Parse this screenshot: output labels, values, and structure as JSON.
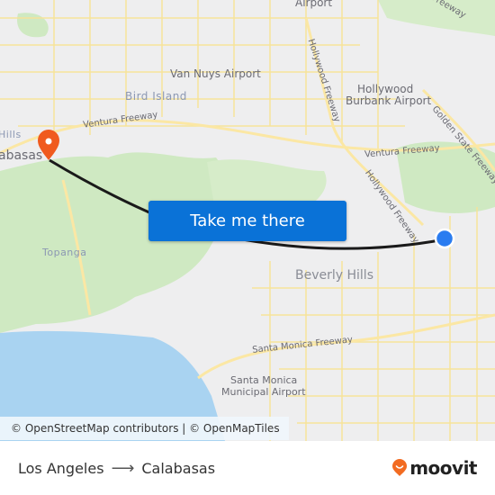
{
  "map": {
    "labels": {
      "airport_top": "Airport",
      "freeway_top_right": "Freeway",
      "van_nuys_airport": "Van Nuys Airport",
      "bird_island": "Bird Island",
      "ventura_freeway_left": "Ventura Freeway",
      "hills": "Hills",
      "calabasas_partial": "abasas",
      "hollywood_freeway_north": "Hollywood Freeway",
      "hollywood_burbank_airport_1": "Hollywood",
      "hollywood_burbank_airport_2": "Burbank Airport",
      "golden_state_freeway": "Golden State Freeway",
      "ventura_freeway_right": "Ventura Freeway",
      "hollywood_freeway_south": "Hollywood Freeway",
      "topanga": "Topanga",
      "beverly_hills": "Beverly Hills",
      "santa_monica_freeway": "Santa Monica Freeway",
      "santa_monica_airport_1": "Santa Monica",
      "santa_monica_airport_2": "Municipal Airport"
    },
    "cta_label": "Take me there",
    "attribution": "© OpenStreetMap contributors | © OpenMapTiles",
    "origin_marker_color": "#2a7cf0",
    "destination_marker_color": "#f05a1e",
    "route_color": "#1a1a1a"
  },
  "footer": {
    "origin": "Los Angeles",
    "destination": "Calabasas",
    "arrow_icon": "arrow-right-icon",
    "brand": "moovit",
    "brand_color": "#f26b21"
  }
}
